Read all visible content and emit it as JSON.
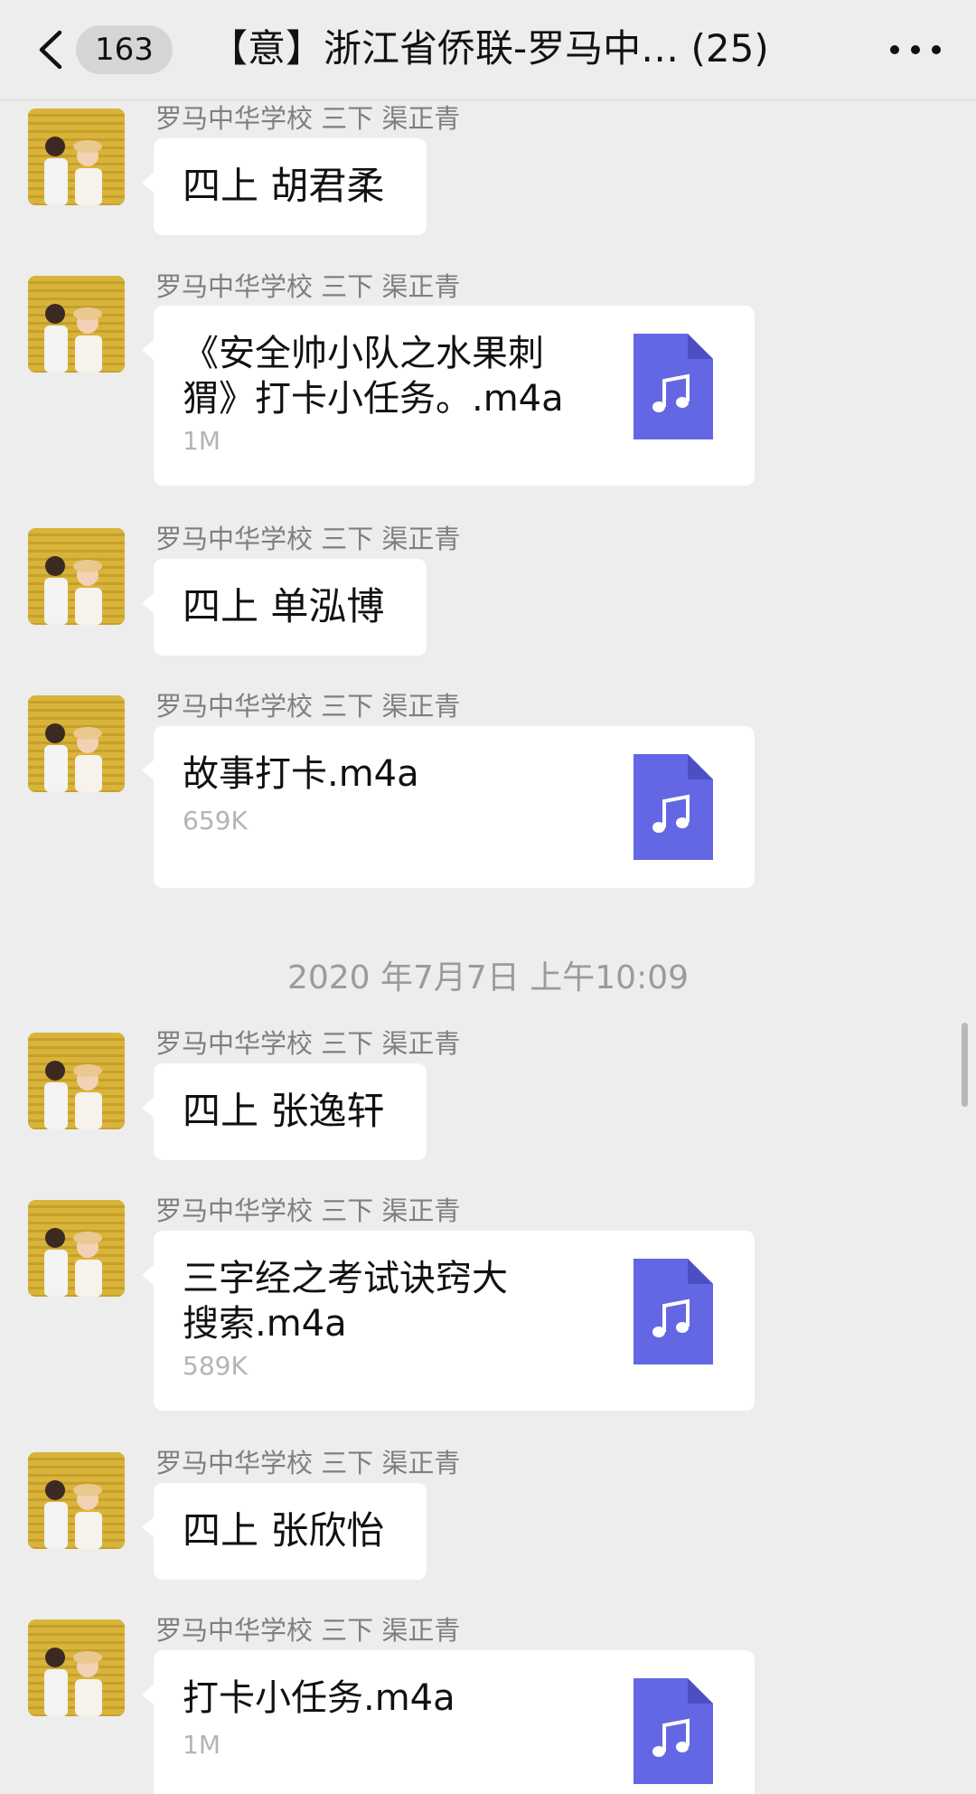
{
  "header": {
    "unread_count": "163",
    "title": "【意】浙江省侨联-罗马中…  (25)"
  },
  "sender_name": "罗马中华学校 三下 渠正青",
  "timestamp": "2020 年7月7日 上午10:09",
  "messages": [
    {
      "type": "text",
      "text": "四上 胡君柔"
    },
    {
      "type": "file",
      "name_line1": "《安全帅小队之水果刺",
      "name_line2": "猬》打卡小任务。.m4a",
      "size": "1M"
    },
    {
      "type": "text",
      "text": "四上 单泓博"
    },
    {
      "type": "file",
      "name_line1": "故事打卡.m4a",
      "name_line2": "",
      "size": "659K"
    },
    {
      "type": "text",
      "text": "四上 张逸轩"
    },
    {
      "type": "file",
      "name_line1": "三字经之考试诀窍大",
      "name_line2": "搜索.m4a",
      "size": "589K"
    },
    {
      "type": "text",
      "text": "四上 张欣怡"
    },
    {
      "type": "file",
      "name_line1": "打卡小任务.m4a",
      "name_line2": "",
      "size": "1M"
    }
  ],
  "icons": {
    "back": "chevron-left-icon",
    "more": "more-dots-icon",
    "file": "music-file-icon"
  },
  "colors": {
    "background": "#ededed",
    "bubble": "#ffffff",
    "file_icon": "#6467e3",
    "meta_text": "#7f7f7f"
  }
}
